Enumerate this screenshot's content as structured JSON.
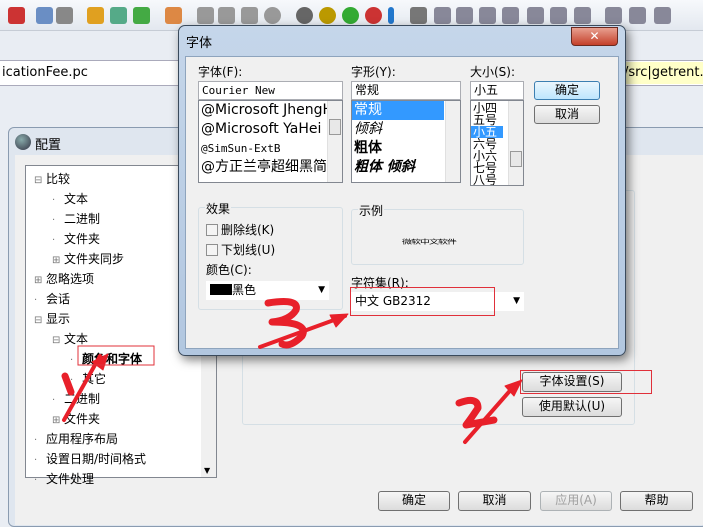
{
  "main_window": {
    "file_left": "icationFee.pc",
    "file_right": "/src|getrent.pc"
  },
  "toolbar": {
    "icons": [
      "layout-icon",
      "panes-icon",
      "settings-gear-icon",
      "list-icon",
      "sync-icon",
      "columns-icon",
      "arrow-down-icon",
      "arrow-up-icon",
      "arrow-left-icon",
      "arrow-right-icon",
      "web-icon",
      "ftp-icon",
      "upload-icon",
      "sftp-icon",
      "info-icon",
      "overflow-icon",
      "folder-icon",
      "binary-icon",
      "filter-icon",
      "document-icon",
      "upload-file-icon",
      "html-icon",
      "help-icon",
      "merge-left-icon",
      "merge-right-icon",
      "merge-icon",
      "window-icon"
    ]
  },
  "config_dialog": {
    "title": "配置",
    "tree": [
      "比较",
      "文本",
      "二进制",
      "文件夹",
      "文件夹同步",
      "忽略选项",
      "会话",
      "显示",
      "文本",
      "颜色和字体",
      "其它",
      "二进制",
      "文件夹",
      "应用程序布局",
      "设置日期/时间格式",
      "文件处理"
    ],
    "font_settings_button": "字体设置(S)",
    "use_default_button": "使用默认(U)",
    "ok": "确定",
    "cancel": "取消",
    "apply": "应用(A)",
    "help": "帮助"
  },
  "font_dialog": {
    "title": "字体",
    "font_label": "字体(F):",
    "font_value": "Courier New",
    "font_list": [
      "@Microsoft JhengHei",
      "@Microsoft YaHei",
      "@SimSun-ExtB",
      "@方正兰亭超细黑简体"
    ],
    "style_label": "字形(Y):",
    "style_value": "常规",
    "style_list": [
      "常规",
      "倾斜",
      "粗体",
      "粗体 倾斜"
    ],
    "size_label": "大小(S):",
    "size_value": "小五",
    "size_list": [
      "小四",
      "五号",
      "小五",
      "六号",
      "小六",
      "七号",
      "八号"
    ],
    "ok": "确定",
    "cancel": "取消",
    "effects_label": "效果",
    "strikeout": "删除线(K)",
    "underline": "下划线(U)",
    "color_label": "颜色(C):",
    "color_value": "黑色",
    "sample_label": "示例",
    "sample_text": "微软中文软件",
    "charset_label": "字符集(R):",
    "charset_value": "中文 GB2312"
  },
  "annotations": [
    "1",
    "2",
    "3"
  ],
  "colors": {
    "accent": "#3399ff",
    "annotation": "#e8202a"
  }
}
